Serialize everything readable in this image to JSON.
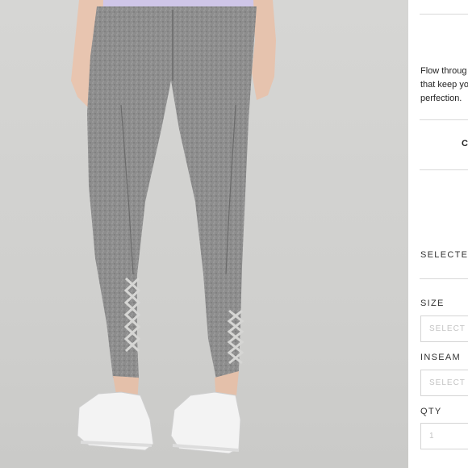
{
  "product": {
    "description_lines": [
      "Flow throug",
      "that keep yo",
      "perfection."
    ],
    "cta_text": "C",
    "selected_label": "SELECTED",
    "size": {
      "label": "SIZE",
      "placeholder": "SELECT"
    },
    "inseam": {
      "label": "INSEAM",
      "placeholder": "SELECT"
    },
    "qty": {
      "label": "QTY",
      "value": "1"
    }
  },
  "photo": {
    "subject": "grey heathered leggings with criss-cross strap ankle cutouts and white sneakers",
    "colors": {
      "background": "#d2d2d0",
      "leggings": "#8a8a8a",
      "shirt": "#cfc6e8",
      "shoes": "#f2f2f2"
    }
  }
}
